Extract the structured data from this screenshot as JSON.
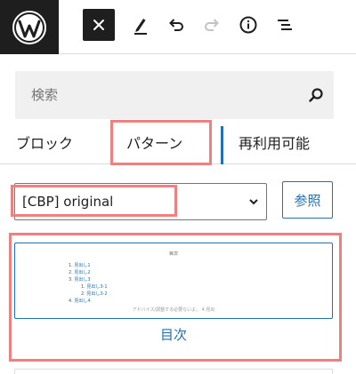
{
  "toolbar": {
    "logo_icon": "wordpress-logo",
    "buttons": [
      {
        "name": "close",
        "icon": "close-icon"
      },
      {
        "name": "tools",
        "icon": "pencil-icon"
      },
      {
        "name": "undo",
        "icon": "undo-icon"
      },
      {
        "name": "redo",
        "icon": "redo-icon"
      },
      {
        "name": "details",
        "icon": "info-icon"
      },
      {
        "name": "list-view",
        "icon": "list-view-icon"
      }
    ]
  },
  "inserter": {
    "search": {
      "placeholder": "検索",
      "value": ""
    },
    "tabs": [
      {
        "label": "ブロック",
        "active": false
      },
      {
        "label": "パターン",
        "active": true
      },
      {
        "label": "再利用可能",
        "active": false
      }
    ],
    "category_select": {
      "value": "[CBP] original"
    },
    "browse_label": "参照",
    "pattern": {
      "label": "目次",
      "preview": {
        "title": "目次",
        "items": [
          {
            "num": "1.",
            "text": "見出し1"
          },
          {
            "num": "2.",
            "text": "見出し2"
          },
          {
            "num": "3.",
            "text": "見出し3"
          },
          {
            "num": "1.",
            "text": "見出し3-1",
            "sub": true
          },
          {
            "num": "2.",
            "text": "見出し3-2",
            "sub": true
          },
          {
            "num": "4.",
            "text": "見出し4"
          }
        ],
        "note": "アドバイス/調整する必要ないよ。 4.見出"
      }
    }
  },
  "colors": {
    "accent": "#2271b1",
    "highlight": "#f08080",
    "dark": "#1e1e1e",
    "search_bg": "#f0f0f0"
  }
}
